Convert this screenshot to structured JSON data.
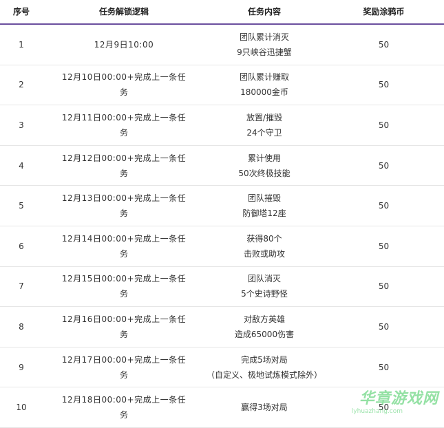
{
  "headers": [
    "序号",
    "任务解锁逻辑",
    "任务内容",
    "奖励涂鸦币"
  ],
  "rows": [
    {
      "no": "1",
      "unlock_a": "12月9日10:00",
      "unlock_b": "",
      "content_a": "团队累计消灭",
      "content_b": "9只峡谷迅捷蟹",
      "reward": "50"
    },
    {
      "no": "2",
      "unlock_a": "12月10日00:00+完成上一条任",
      "unlock_b": "务",
      "content_a": "团队累计赚取",
      "content_b": "180000金币",
      "reward": "50"
    },
    {
      "no": "3",
      "unlock_a": "12月11日00:00+完成上一条任",
      "unlock_b": "务",
      "content_a": "放置/摧毁",
      "content_b": "24个守卫",
      "reward": "50"
    },
    {
      "no": "4",
      "unlock_a": "12月12日00:00+完成上一条任",
      "unlock_b": "务",
      "content_a": "累计使用",
      "content_b": "50次终极技能",
      "reward": "50"
    },
    {
      "no": "5",
      "unlock_a": "12月13日00:00+完成上一条任",
      "unlock_b": "务",
      "content_a": "团队摧毁",
      "content_b": "防御塔12座",
      "reward": "50"
    },
    {
      "no": "6",
      "unlock_a": "12月14日00:00+完成上一条任",
      "unlock_b": "务",
      "content_a": "获得80个",
      "content_b": "击败或助攻",
      "reward": "50"
    },
    {
      "no": "7",
      "unlock_a": "12月15日00:00+完成上一条任",
      "unlock_b": "务",
      "content_a": "团队消灭",
      "content_b": "5个史诗野怪",
      "reward": "50"
    },
    {
      "no": "8",
      "unlock_a": "12月16日00:00+完成上一条任",
      "unlock_b": "务",
      "content_a": "对敌方英雄",
      "content_b": "造成65000伤害",
      "reward": "50"
    },
    {
      "no": "9",
      "unlock_a": "12月17日00:00+完成上一条任",
      "unlock_b": "务",
      "content_a": "完成5场对局",
      "content_b": "（自定义、极地试炼模式除外）",
      "reward": "50"
    },
    {
      "no": "10",
      "unlock_a": "12月18日00:00+完成上一条任",
      "unlock_b": "务",
      "content_a": "赢得3场对局",
      "content_b": "",
      "reward": "50"
    }
  ],
  "watermark": {
    "text": "华章游戏网",
    "url": "lyhuazhang.com"
  },
  "colors": {
    "header_rule": "#6b4f9e",
    "row_rule": "#e6e6e6"
  }
}
